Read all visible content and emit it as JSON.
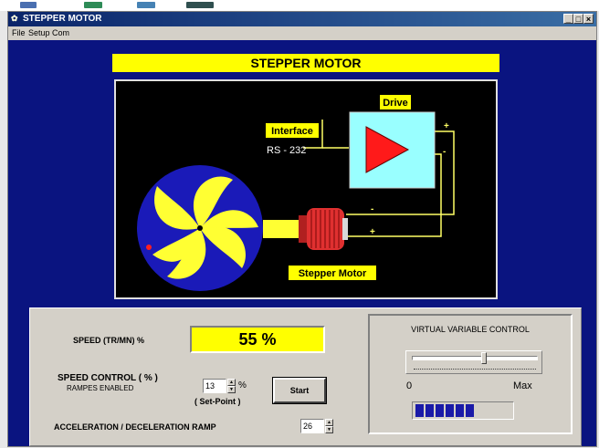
{
  "window": {
    "title": "STEPPER MOTOR",
    "minimize_label": "_",
    "maximize_label": "□",
    "close_label": "×"
  },
  "menu": {
    "items": [
      "File",
      "Setup Com"
    ]
  },
  "banner": {
    "title": "STEPPER MOTOR"
  },
  "diagram": {
    "drive_label": "Drive",
    "interface_label": "Interface",
    "rs232_label": "RS - 232",
    "motor_label": "Stepper Motor",
    "plus": "+",
    "minus": "-",
    "drive_minus": "-",
    "motor_plus": "+",
    "colors": {
      "background": "#000000",
      "wheel": "#1a1ab8",
      "wheel_blades": "#ffff33",
      "label_bg": "#ffff00",
      "drive_box": "#99ffff",
      "triangle": "#ff1a1a",
      "motor": "#e03030",
      "wires": "#ffff66"
    }
  },
  "controls": {
    "speed_label": "SPEED (TR/MN) %",
    "speed_value": "55 %",
    "speed_control_label": "SPEED CONTROL ( % )",
    "rampes_label": "RAMPES ENABLED",
    "setpoint_value": "13",
    "setpoint_unit": "%",
    "setpoint_caption": "( Set-Point )",
    "start_label": "Start",
    "ramp_label": "ACCELERATION / DECELERATION  RAMP",
    "ramp_value": "26",
    "spin_up": "▲",
    "spin_down": "▼"
  },
  "virtual_control": {
    "title": "VIRTUAL VARIABLE CONTROL",
    "min_label": "0",
    "max_label": "Max",
    "slider_fraction": 0.58,
    "progress_segments": 6,
    "progress_total_segments": 10
  }
}
